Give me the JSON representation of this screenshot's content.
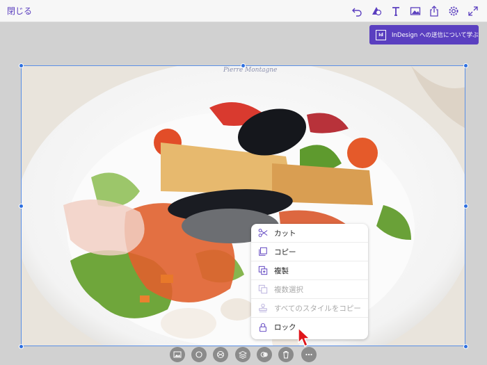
{
  "toolbar": {
    "close_label": "閉じる",
    "icons": [
      "undo-icon",
      "shape-icon",
      "text-icon",
      "image-icon",
      "share-icon",
      "settings-icon",
      "expand-icon"
    ],
    "accent": "#5b3fbf"
  },
  "indesign_button": {
    "logo": "Id",
    "label": "InDesign への送信について学ぶ"
  },
  "photo": {
    "plate_text": "Pierre Montagne"
  },
  "context_menu": {
    "items": [
      {
        "label": "カット",
        "icon": "scissors-icon",
        "enabled": true
      },
      {
        "label": "コピー",
        "icon": "copy-icon",
        "enabled": true
      },
      {
        "label": "複製",
        "icon": "duplicate-icon",
        "enabled": true
      },
      {
        "label": "複数選択",
        "icon": "multi-select-icon",
        "enabled": false
      },
      {
        "label": "すべてのスタイルをコピー",
        "icon": "stamp-icon",
        "enabled": false
      },
      {
        "label": "ロック",
        "icon": "lock-icon",
        "enabled": true
      }
    ]
  },
  "bottom_tools": [
    "replace-image-icon",
    "shape-mask-icon",
    "pattern-icon",
    "layers-icon",
    "blend-icon",
    "delete-icon",
    "more-icon"
  ]
}
